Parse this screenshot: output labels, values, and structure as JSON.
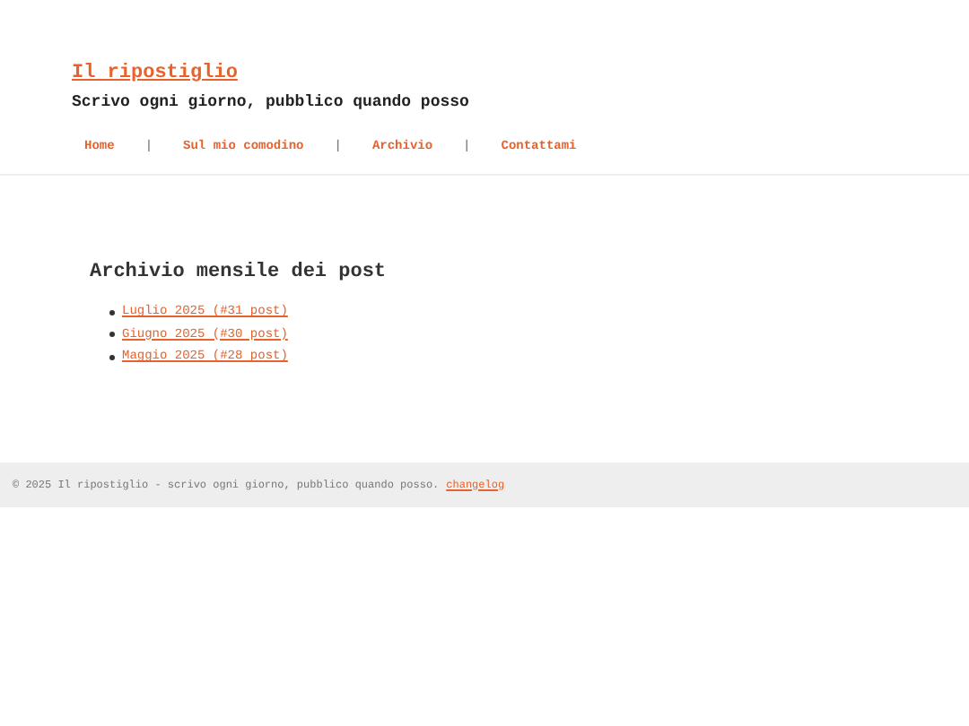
{
  "site": {
    "title": "Il ripostiglio",
    "tagline": "Scrivo ogni giorno, pubblico quando posso"
  },
  "nav": {
    "separator": "|",
    "items": [
      {
        "label": "Home"
      },
      {
        "label": "Sul mio comodino"
      },
      {
        "label": "Archivio"
      },
      {
        "label": "Contattami"
      }
    ]
  },
  "archive": {
    "heading": "Archivio mensile dei post",
    "items": [
      {
        "label": "Luglio 2025 (#31 post)"
      },
      {
        "label": "Giugno 2025 (#30 post)"
      },
      {
        "label": "Maggio 2025 (#28 post)"
      }
    ]
  },
  "footer": {
    "text": "© 2025 Il ripostiglio - scrivo ogni giorno, pubblico quando posso.",
    "link": "changelog"
  }
}
